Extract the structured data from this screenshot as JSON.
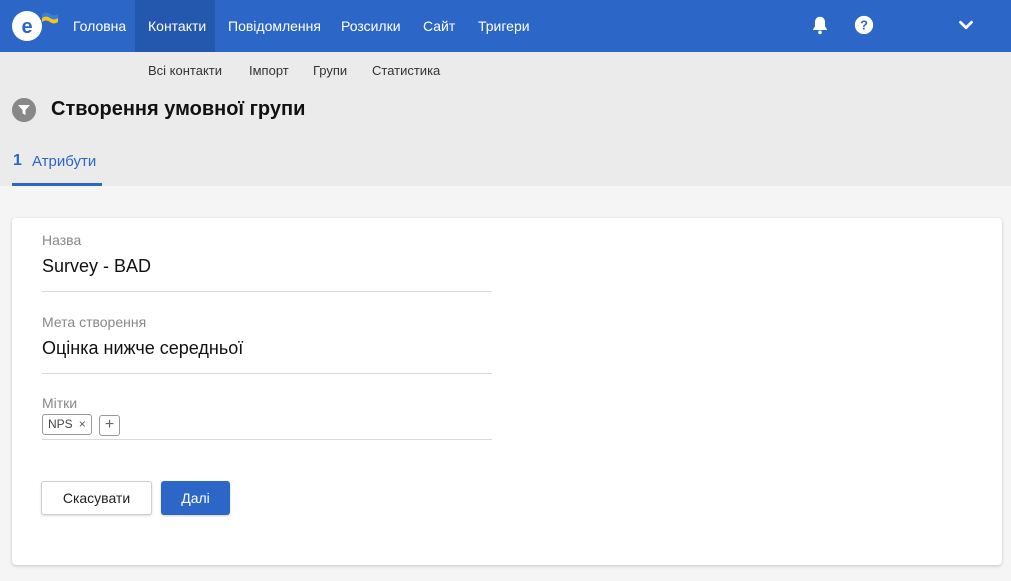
{
  "nav": {
    "items": [
      {
        "label": "Головна"
      },
      {
        "label": "Контакти"
      },
      {
        "label": "Повідомлення"
      },
      {
        "label": "Розсилки"
      },
      {
        "label": "Сайт"
      },
      {
        "label": "Тригери"
      }
    ],
    "active": "Контакти",
    "icons": [
      "bell-icon",
      "help-icon",
      "chevron-down-icon"
    ]
  },
  "subnav": {
    "items": [
      {
        "label": "Всі контакти"
      },
      {
        "label": "Імпорт"
      },
      {
        "label": "Групи"
      },
      {
        "label": "Статистика"
      }
    ]
  },
  "page": {
    "title": "Створення умовної групи",
    "icon": "filter-icon"
  },
  "steps": [
    {
      "number": "1",
      "label": "Атрибути"
    }
  ],
  "form": {
    "name_label": "Назва",
    "name_value": "Survey - BAD",
    "purpose_label": "Мета створення",
    "purpose_value": "Оцінка нижче середньої",
    "tags_label": "Мітки",
    "tags": [
      "NPS"
    ],
    "tag_remove": "×",
    "tag_add": "+"
  },
  "buttons": {
    "cancel": "Скасувати",
    "next": "Далі"
  },
  "colors": {
    "brand": "#2c67c8",
    "brand_active": "#2458ae",
    "flag_blue": "#3b7fd4",
    "flag_yellow": "#f5c518"
  }
}
